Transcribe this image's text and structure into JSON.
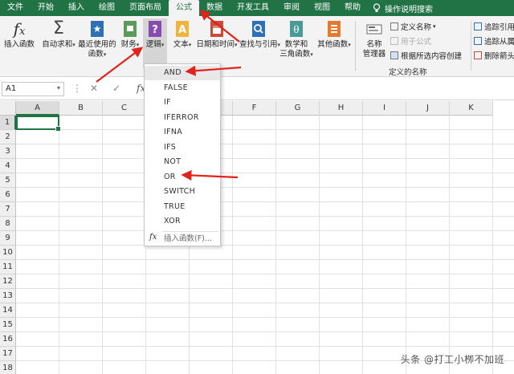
{
  "menu": {
    "tabs": [
      "文件",
      "开始",
      "插入",
      "绘图",
      "页面布局",
      "公式",
      "数据",
      "开发工具",
      "审阅",
      "视图",
      "帮助"
    ],
    "active": "公式",
    "search_label": "操作说明搜索"
  },
  "ribbon": {
    "insert_function": "插入函数",
    "autosum_line1": "自动求和",
    "recent_line1": "最近使用的",
    "recent_line2": "函数",
    "financial": "财务",
    "logical": "逻辑",
    "text": "文本",
    "datetime": "日期和时间",
    "lookup": "查找与引用",
    "math_line1": "数学和",
    "math_line2": "三角函数",
    "more": "其他函数",
    "name_mgr_line1": "名称",
    "name_mgr_line2": "管理器",
    "define_name": "定义名称",
    "use_in_formula": "用于公式",
    "create_from_sel": "根据所选内容创建",
    "defined_names_group": "定义的名称",
    "trace_precedents": "追踪引用",
    "trace_dependents": "追踪从属",
    "remove_arrows": "删除箭头"
  },
  "formula_bar": {
    "name_box": "A1",
    "fx": "fx"
  },
  "grid": {
    "columns": [
      "A",
      "B",
      "C",
      "D",
      "E",
      "F",
      "G",
      "H",
      "I",
      "J",
      "K"
    ],
    "rows": [
      "1",
      "2",
      "3",
      "4",
      "5",
      "6",
      "7",
      "8",
      "9",
      "10",
      "11",
      "12",
      "13",
      "14",
      "15",
      "16",
      "17",
      "18"
    ]
  },
  "logical_menu": {
    "items": [
      "AND",
      "FALSE",
      "IF",
      "IFERROR",
      "IFNA",
      "IFS",
      "NOT",
      "OR",
      "SWITCH",
      "TRUE",
      "XOR"
    ],
    "insert_function": "插入函数(F)...",
    "fx": "fx"
  },
  "watermark": "头条 @打工小栁不加班",
  "colors": {
    "accent": "#217346",
    "arrow": "#e0241b"
  }
}
